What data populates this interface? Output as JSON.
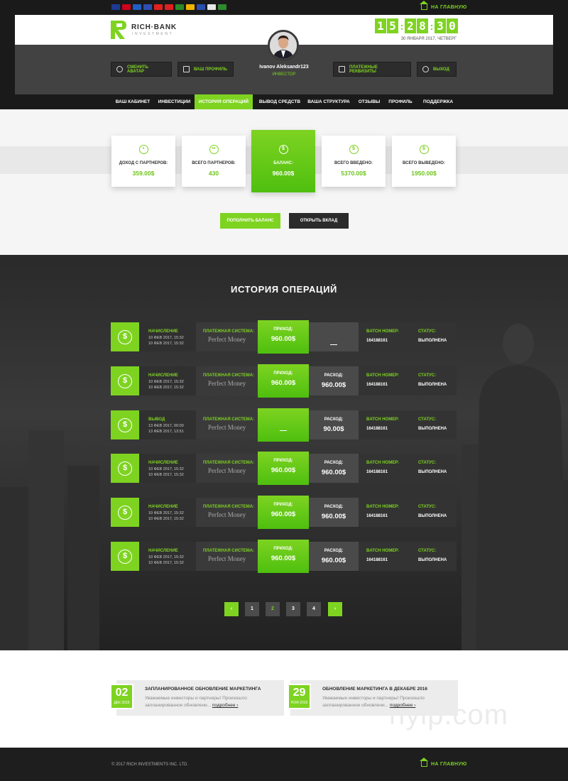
{
  "topbar": {
    "flags": [
      {
        "name": "usa-flag-icon",
        "color": "#1f3a93"
      },
      {
        "name": "germany-flag-icon",
        "color": "#d0021b"
      },
      {
        "name": "russia-flag-icon",
        "color": "#1f5fc4"
      },
      {
        "name": "france-flag-icon",
        "color": "#2f4fb0"
      },
      {
        "name": "china-flag-icon",
        "color": "#e02020"
      },
      {
        "name": "vietnam-flag-icon",
        "color": "#e02020"
      },
      {
        "name": "portugal-flag-icon",
        "color": "#2a8a2a"
      },
      {
        "name": "spain-flag-icon",
        "color": "#f0b400"
      },
      {
        "name": "philippines-flag-icon",
        "color": "#2a4fb0"
      },
      {
        "name": "poland-flag-icon",
        "color": "#e8e8e8"
      },
      {
        "name": "arabic-flag-icon",
        "color": "#2e8b2e"
      }
    ],
    "home_label": "НА ГЛАВНУЮ"
  },
  "header": {
    "logo_text": "RICH·BANK",
    "logo_sub": "INVESTMENT",
    "clock": {
      "h1": "1",
      "h2": "5",
      "m1": "2",
      "m2": "8",
      "s1": "3",
      "s2": "0"
    },
    "date": "30 ЯНВАРЯ 2017, ЧЕТВЕРГ",
    "user_name": "Ivanov Aleksandr123",
    "user_role": "ИНВЕСТОР",
    "buttons": {
      "avatar": "СМЕНИТЬ АВАТАР",
      "profile": "ВАШ ПРОФИЛЬ",
      "payment": "ПЛАТЕЖНЫЕ РЕКВИЗИТЫ",
      "logout": "ВЫХОД"
    }
  },
  "nav": [
    "ВАШ КАБИНЕТ",
    "ИНВЕСТИЦИИ",
    "ИСТОРИЯ ОПЕРАЦИЙ",
    "ВЫВОД СРЕДСТВ",
    "ВАША СТРУКТУРА",
    "ОТЗЫВЫ",
    "ПРОФИЛЬ",
    "ПОДДЕРЖКА"
  ],
  "stats": [
    {
      "label": "ДОХОД С ПАРТНЕРОВ:",
      "value": "359.00$",
      "icon": "user-icon"
    },
    {
      "label": "ВСЕГО ПАРТНЕРОВ:",
      "value": "430",
      "icon": "users-icon"
    },
    {
      "label": "БАЛАНС:",
      "value": "960.00$",
      "icon": "dollar-icon"
    },
    {
      "label": "ВСЕГО ВВЕДЕНО:",
      "value": "5370.00$",
      "icon": "dollar-in-icon"
    },
    {
      "label": "ВСЕГО ВЫВЕДЕНО:",
      "value": "1950.00$",
      "icon": "dollar-out-icon"
    }
  ],
  "actions": {
    "deposit": "ПОПОЛНИТЬ БАЛАНС",
    "open": "ОТКРЫТЬ ВКЛАД"
  },
  "history": {
    "title": "ИСТОРИЯ ОПЕРАЦИЙ",
    "pay_label": "ПЛАТЕЖНАЯ СИСТЕМА:",
    "pay_system": "Perfect Money",
    "in_label": "ПРИХОД:",
    "out_label": "РАСХОД:",
    "batch_label": "BATCH НОМЕР:",
    "status_label": "СТАТУС:",
    "rows": [
      {
        "type": "НАЧИСЛЕНИЕ",
        "d1": "10 ФЕВ 2017, 15:32",
        "d2": "10 ФЕВ 2017, 15:32",
        "in": "960.00$",
        "out": "—",
        "batch": "164188161",
        "status": "ВЫПОЛНЕНА"
      },
      {
        "type": "НАЧИСЛЕНИЕ",
        "d1": "10 ФЕВ 2017, 15:32",
        "d2": "10 ФЕВ 2017, 15:32",
        "in": "960.00$",
        "out": "960.00$",
        "batch": "164188161",
        "status": "ВЫПОЛНЕНА"
      },
      {
        "type": "ВЫВОД",
        "d1": "13 ФЕВ 2017, 00:00",
        "d2": "13 ФЕВ 2017, 13:51",
        "in": "—",
        "out": "90.00$",
        "batch": "164188161",
        "status": "ВЫПОЛНЕНА"
      },
      {
        "type": "НАЧИСЛЕНИЕ",
        "d1": "10 ФЕВ 2017, 15:32",
        "d2": "10 ФЕВ 2017, 15:32",
        "in": "960.00$",
        "out": "960.00$",
        "batch": "164188161",
        "status": "ВЫПОЛНЕНА"
      },
      {
        "type": "НАЧИСЛЕНИЕ",
        "d1": "10 ФЕВ 2017, 15:32",
        "d2": "10 ФЕВ 2017, 15:32",
        "in": "960.00$",
        "out": "960.00$",
        "batch": "164188161",
        "status": "ВЫПОЛНЕНА"
      },
      {
        "type": "НАЧИСЛЕНИЕ",
        "d1": "10 ФЕВ 2017, 15:32",
        "d2": "10 ФЕВ 2017, 15:32",
        "in": "960.00$",
        "out": "960.00$",
        "batch": "164188161",
        "status": "ВЫПОЛНЕНА"
      }
    ]
  },
  "pagination": {
    "prev": "‹",
    "pages": [
      "1",
      "2",
      "3",
      "4"
    ],
    "current": "2",
    "next": "›"
  },
  "news": [
    {
      "day": "02",
      "month": "ДЕК 2016",
      "title": "ЗАПЛАНИРОВАННОЕ ОБНОВЛЕНИЕ МАРКЕТИНГА",
      "text": "Уважаемые инвесторы и партнеры! Произошло запланированное обновлени...",
      "more": "подробнее ›"
    },
    {
      "day": "29",
      "month": "НОЯ 2016",
      "title": "ОБНОВЛЕНИЕ МАРКЕТИНГА В ДЕКАБРЕ 2016",
      "text": "Уважаемые инвесторы и партнеры! Произошло запланированное обновлени...",
      "more": "подробнее ›"
    }
  ],
  "watermark": "hyip.com",
  "footer": {
    "copyright": "© 2017 RICH INVESTMENTS INC. LTD.",
    "home_label": "НА ГЛАВНУЮ"
  }
}
